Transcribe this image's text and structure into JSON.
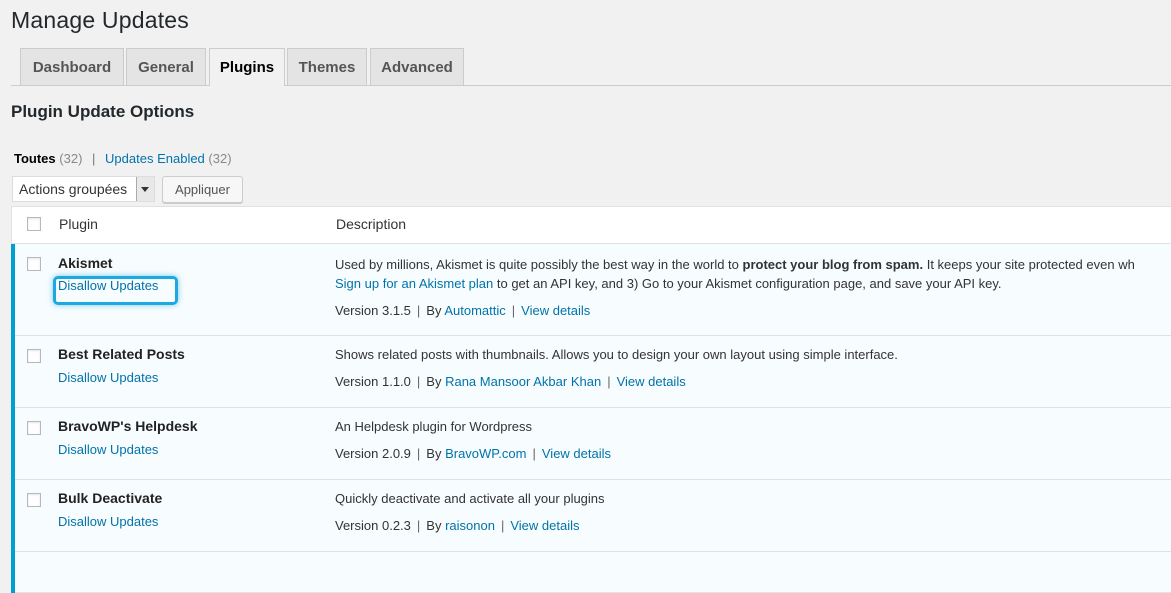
{
  "page": {
    "title": "Manage Updates"
  },
  "tabs": [
    {
      "label": "Dashboard",
      "active": false
    },
    {
      "label": "General",
      "active": false
    },
    {
      "label": "Plugins",
      "active": true
    },
    {
      "label": "Themes",
      "active": false
    },
    {
      "label": "Advanced",
      "active": false
    }
  ],
  "section": {
    "title": "Plugin Update Options"
  },
  "filters": {
    "all_label": "Toutes",
    "all_count": "(32)",
    "separator": "|",
    "enabled_label": "Updates Enabled",
    "enabled_count": "(32)"
  },
  "bulk": {
    "select_value": "Actions groupées",
    "apply_label": "Appliquer"
  },
  "table": {
    "col_plugin": "Plugin",
    "col_description": "Description",
    "rows": [
      {
        "name": "Akismet",
        "action": "Disallow Updates",
        "desc_line1_pre": "Used by millions, Akismet is quite possibly the best way in the world to ",
        "desc_line1_bold": "protect your blog from spam.",
        "desc_line1_post": " It keeps your site protected even wh",
        "desc_line2_link": "Sign up for an Akismet plan",
        "desc_line2_post": " to get an API key, and 3) Go to your Akismet configuration page, and save your API key.",
        "version": "Version 3.1.5",
        "by": "By",
        "author": "Automattic",
        "view_details": "View details"
      },
      {
        "name": "Best Related Posts",
        "action": "Disallow Updates",
        "desc": "Shows related posts with thumbnails. Allows you to design your own layout using simple interface.",
        "version": "Version 1.1.0",
        "by": "By",
        "author": "Rana Mansoor Akbar Khan",
        "view_details": "View details"
      },
      {
        "name": "BravoWP's Helpdesk",
        "action": "Disallow Updates",
        "desc": "An Helpdesk plugin for Wordpress",
        "version": "Version 2.0.9",
        "by": "By",
        "author": "BravoWP.com",
        "view_details": "View details"
      },
      {
        "name": "Bulk Deactivate",
        "action": "Disallow Updates",
        "desc": "Quickly deactivate and activate all your plugins",
        "version": "Version 0.2.3",
        "by": "By",
        "author": "raisonon",
        "view_details": "View details"
      }
    ]
  },
  "colors": {
    "link": "#0073aa",
    "active_bar": "#00a0d2",
    "highlight": "#1ba9e0"
  }
}
